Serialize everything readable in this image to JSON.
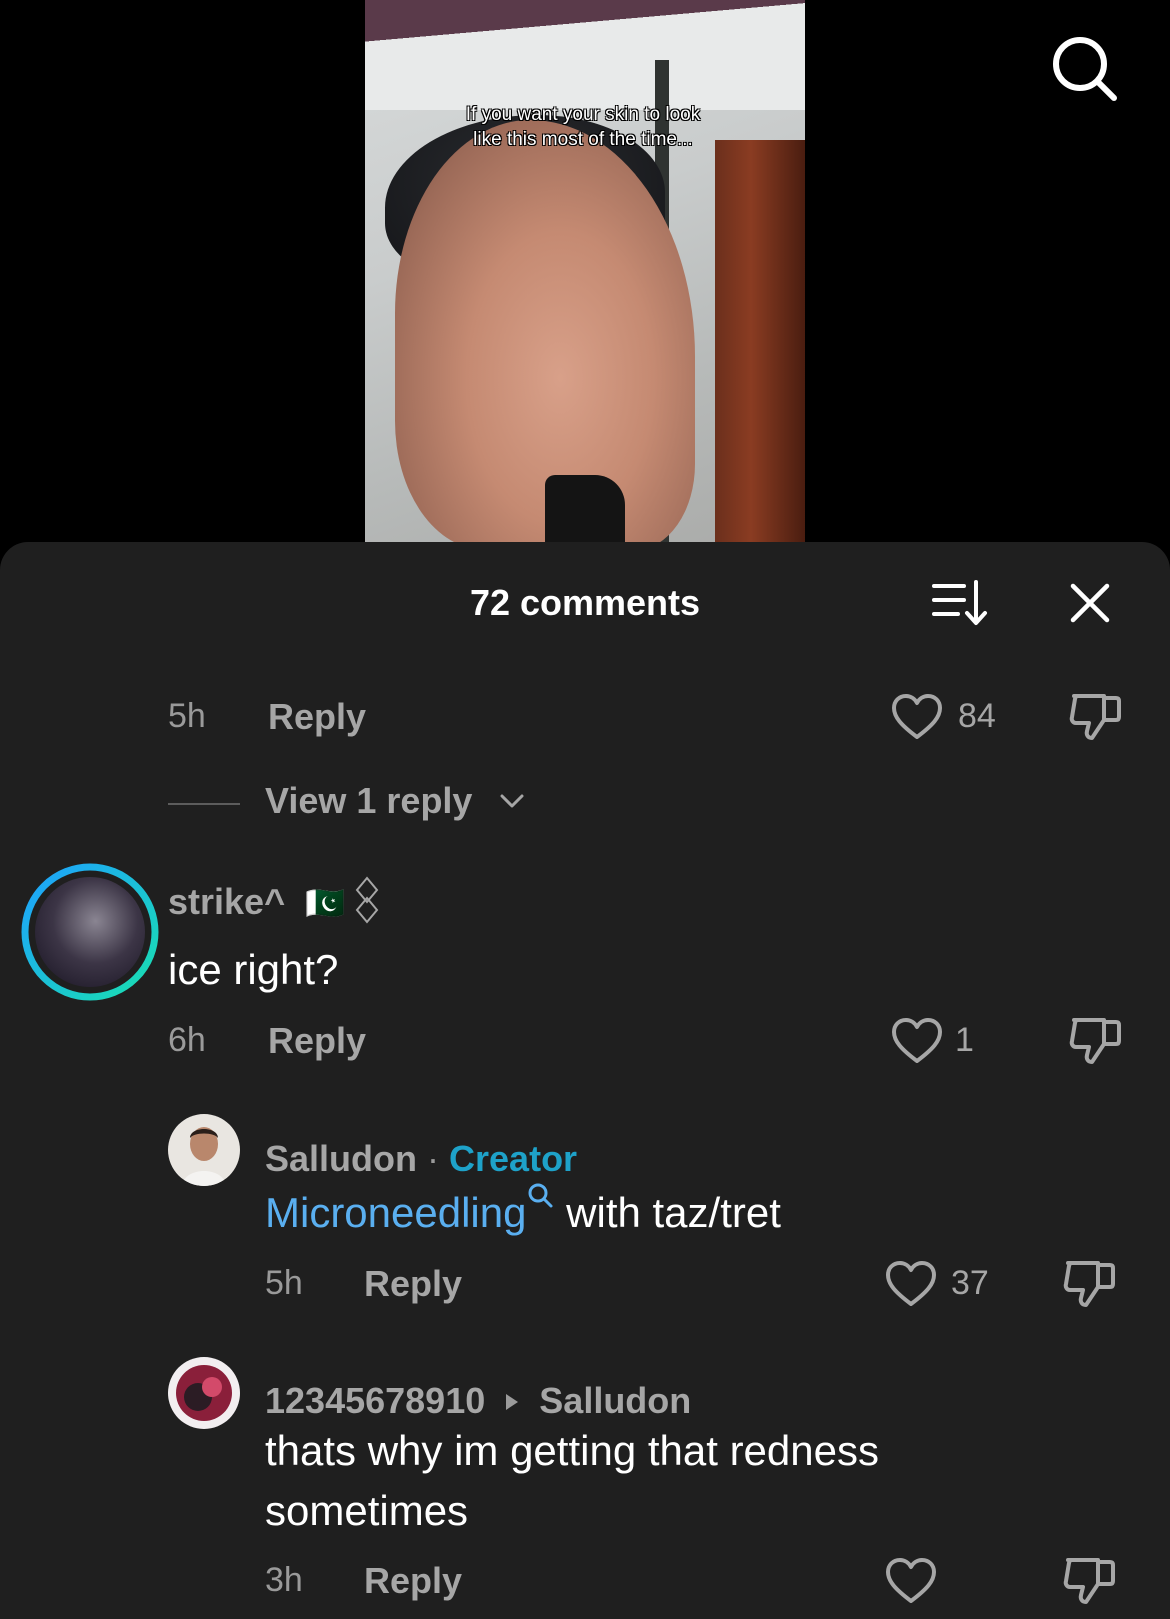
{
  "video": {
    "caption": "If you want your skin to look like this most of the time..."
  },
  "header": {
    "title": "72 comments"
  },
  "comments": {
    "c0": {
      "time": "5h",
      "reply": "Reply",
      "likes": "84",
      "view_replies": "View 1 reply"
    },
    "c1": {
      "username": "strike^",
      "flag": "🇵🇰",
      "text": "ice right?",
      "time": "6h",
      "reply": "Reply",
      "likes": "1"
    },
    "r1": {
      "username": "Salludon",
      "separator": "·",
      "badge": "Creator",
      "link_text": "Microneedling",
      "text": " with taz/tret",
      "time": "5h",
      "reply": "Reply",
      "likes": "37"
    },
    "r2": {
      "username": "12345678910",
      "reply_to": "Salludon",
      "text": "thats why im getting that redness sometimes",
      "time": "3h",
      "reply": "Reply"
    }
  },
  "colors": {
    "sheet_bg": "#1f1f1f",
    "creator_badge": "#1ea2c9",
    "link": "#5aaff0",
    "story_ring_start": "#1ea0ff",
    "story_ring_end": "#19e0b0"
  },
  "icons": [
    "search-icon",
    "sort-icon",
    "close-icon",
    "heart-icon",
    "thumbs-down-icon",
    "chevron-down-icon",
    "search-small-icon",
    "play-arrow-icon"
  ]
}
